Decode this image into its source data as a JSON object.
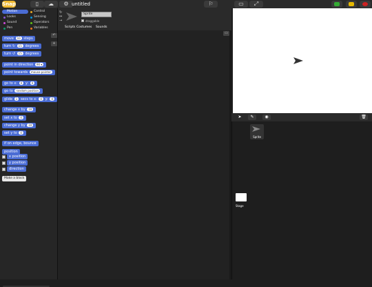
{
  "app": {
    "logo_text": "Snap",
    "title": "untitled"
  },
  "categories": [
    {
      "label": "Motion",
      "color": "#4a6cd4",
      "selected": true
    },
    {
      "label": "Control",
      "color": "#e6a822"
    },
    {
      "label": "Looks",
      "color": "#8a55d7"
    },
    {
      "label": "Sensing",
      "color": "#0494dc"
    },
    {
      "label": "Sound",
      "color": "#cf4ad9"
    },
    {
      "label": "Operators",
      "color": "#62c213"
    },
    {
      "label": "Pen",
      "color": "#0e9a6c"
    },
    {
      "label": "Variables",
      "color": "#f3761d"
    }
  ],
  "blocks": {
    "move": {
      "label": "move",
      "value": "10",
      "suffix": "steps"
    },
    "turn_cw": {
      "label": "turn",
      "symbol": "↻",
      "value": "15",
      "suffix": "degrees"
    },
    "turn_ccw": {
      "label": "turn",
      "symbol": "↺",
      "value": "15",
      "suffix": "degrees"
    },
    "point_dir": {
      "label": "point in direction",
      "value": "90 ▾"
    },
    "point_towards": {
      "label": "point towards",
      "value": "mouse-pointer"
    },
    "goto_xy": {
      "label": "go to x:",
      "x": "0",
      "y_label": "y:",
      "y": "0"
    },
    "goto": {
      "label": "go to",
      "value": "random position"
    },
    "glide": {
      "label": "glide",
      "secs": "1",
      "mid": "secs to x:",
      "x": "0",
      "y_label": "y:",
      "y": "0"
    },
    "change_x": {
      "label": "change x by",
      "value": "10"
    },
    "set_x": {
      "label": "set x to",
      "value": "0"
    },
    "change_y": {
      "label": "change y by",
      "value": "10"
    },
    "set_y": {
      "label": "set y to",
      "value": "0"
    },
    "bounce": {
      "label": "if on edge, bounce"
    },
    "position": {
      "label": "position"
    },
    "x_position": {
      "label": "x position"
    },
    "y_position": {
      "label": "y position"
    },
    "direction": {
      "label": "direction"
    }
  },
  "make_block": "Make a block",
  "sprite": {
    "name": "Sprite",
    "draggable_label": "draggable"
  },
  "tabs": [
    "Scripts",
    "Costumes",
    "Sounds"
  ],
  "corral": {
    "sprite_label": "Sprite",
    "stage_label": "Stage"
  },
  "colors": {
    "motion": "#4a6cd4",
    "green_flag": "#33aa33",
    "pause": "#e6b800",
    "stop": "#cc2222"
  },
  "icons": [
    "file-icon",
    "cloud-icon",
    "gear-icon",
    "turtle-icon",
    "stage-size-icon",
    "fullscreen-icon",
    "arrow-icon",
    "paintbrush-icon",
    "camera-icon",
    "trash-icon"
  ]
}
